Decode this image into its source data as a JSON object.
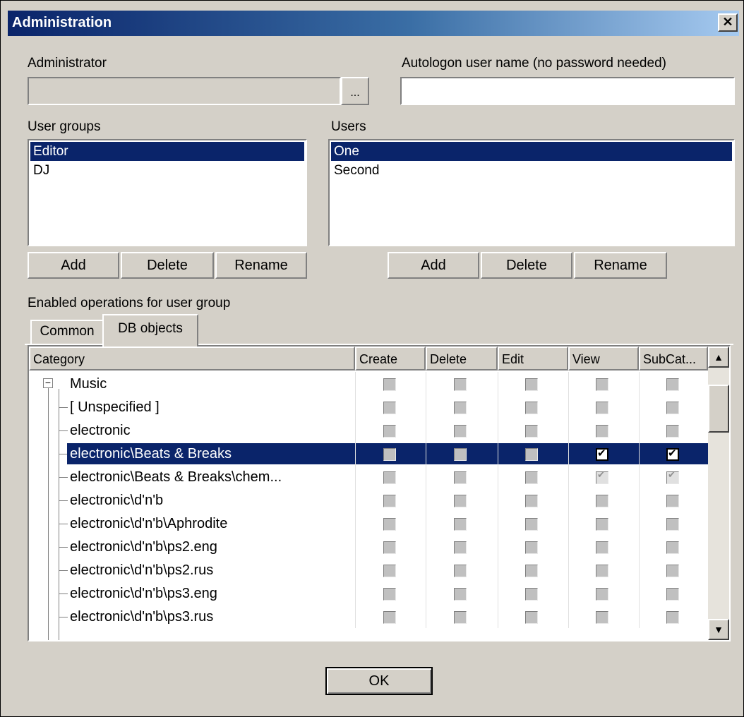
{
  "window": {
    "title": "Administration",
    "close_label": "✕"
  },
  "administrator": {
    "label": "Administrator",
    "value": "",
    "browse_label": "..."
  },
  "autologon": {
    "label": "Autologon user name (no password needed)",
    "value": ""
  },
  "user_groups": {
    "label": "User groups",
    "items": [
      {
        "label": "Editor",
        "selected": true
      },
      {
        "label": "DJ",
        "selected": false
      }
    ],
    "add_label": "Add",
    "delete_label": "Delete",
    "rename_label": "Rename"
  },
  "users": {
    "label": "Users",
    "items": [
      {
        "label": "One",
        "selected": true
      },
      {
        "label": "Second",
        "selected": false
      }
    ],
    "add_label": "Add",
    "delete_label": "Delete",
    "rename_label": "Rename"
  },
  "operations": {
    "label": "Enabled operations for user group",
    "tabs": [
      {
        "label": "Common",
        "active": false
      },
      {
        "label": "DB objects",
        "active": true
      }
    ]
  },
  "grid": {
    "columns": [
      "Category",
      "Create",
      "Delete",
      "Edit",
      "View",
      "SubCat..."
    ],
    "rows": [
      {
        "name": "Music",
        "level": 0,
        "checks": [
          "off",
          "off",
          "off",
          "off",
          "off"
        ]
      },
      {
        "name": "[ Unspecified ]",
        "level": 1,
        "checks": [
          "off",
          "off",
          "off",
          "off",
          "off"
        ]
      },
      {
        "name": "electronic",
        "level": 1,
        "checks": [
          "off",
          "off",
          "off",
          "off",
          "off"
        ]
      },
      {
        "name": "electronic\\Beats & Breaks",
        "level": 1,
        "selected": true,
        "checks": [
          "off",
          "off",
          "off",
          "on",
          "on"
        ]
      },
      {
        "name": "electronic\\Beats & Breaks\\chem...",
        "level": 1,
        "checks": [
          "off",
          "off",
          "off",
          "grey",
          "grey"
        ]
      },
      {
        "name": "electronic\\d'n'b",
        "level": 1,
        "checks": [
          "off",
          "off",
          "off",
          "off",
          "off"
        ]
      },
      {
        "name": "electronic\\d'n'b\\Aphrodite",
        "level": 1,
        "checks": [
          "off",
          "off",
          "off",
          "off",
          "off"
        ]
      },
      {
        "name": "electronic\\d'n'b\\ps2.eng",
        "level": 1,
        "checks": [
          "off",
          "off",
          "off",
          "off",
          "off"
        ]
      },
      {
        "name": "electronic\\d'n'b\\ps2.rus",
        "level": 1,
        "checks": [
          "off",
          "off",
          "off",
          "off",
          "off"
        ]
      },
      {
        "name": "electronic\\d'n'b\\ps3.eng",
        "level": 1,
        "checks": [
          "off",
          "off",
          "off",
          "off",
          "off"
        ]
      },
      {
        "name": "electronic\\d'n'b\\ps3.rus",
        "level": 1,
        "checks": [
          "off",
          "off",
          "off",
          "off",
          "off"
        ]
      }
    ]
  },
  "ok_label": "OK"
}
